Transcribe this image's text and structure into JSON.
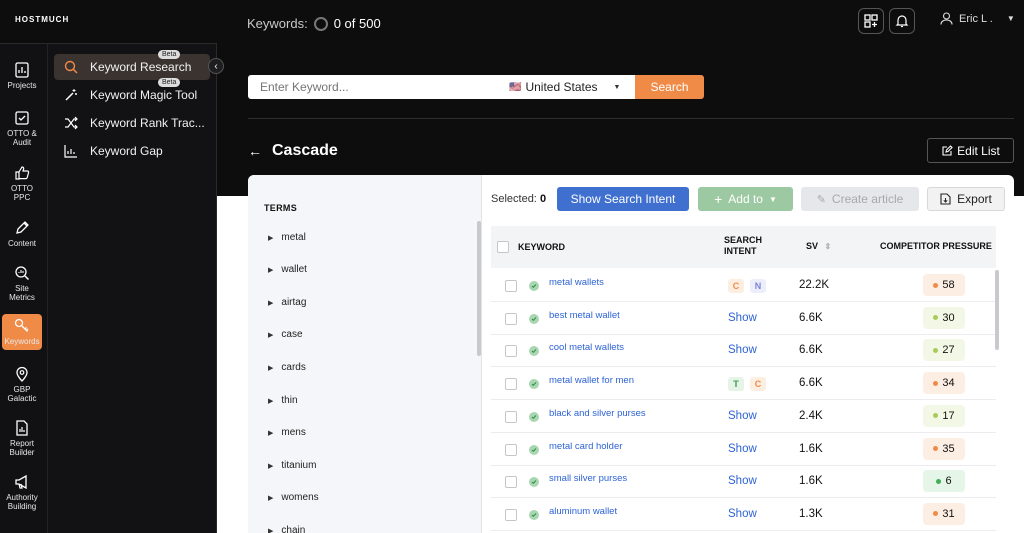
{
  "brand": "HOSTMUCH",
  "credits": {
    "label": "Keywords:",
    "value": "0 of 500"
  },
  "user": {
    "name": "Eric L ."
  },
  "rail": [
    {
      "label": "Projects",
      "icon": "chart-doc-icon"
    },
    {
      "label": "OTTO & Audit",
      "icon": "audit-icon"
    },
    {
      "label": "OTTO PPC",
      "icon": "thumbs-up-icon"
    },
    {
      "label": "Content",
      "icon": "pen-icon"
    },
    {
      "label": "Site Metrics",
      "icon": "metrics-icon"
    },
    {
      "label": "Keywords",
      "icon": "key-icon"
    },
    {
      "label": "GBP Galactic",
      "icon": "map-pin-icon"
    },
    {
      "label": "Report Builder",
      "icon": "report-icon"
    },
    {
      "label": "Authority Building",
      "icon": "megaphone-icon"
    }
  ],
  "submenu": [
    {
      "label": "Keyword Research",
      "badge": "Beta",
      "icon": "search-icon"
    },
    {
      "label": "Keyword Magic Tool",
      "badge": "Beta",
      "icon": "magic-wand-icon"
    },
    {
      "label": "Keyword Rank Trac...",
      "badge": "",
      "icon": "shuffle-icon"
    },
    {
      "label": "Keyword Gap",
      "badge": "",
      "icon": "gap-chart-icon"
    }
  ],
  "search": {
    "placeholder": "Enter Keyword...",
    "country": "United States",
    "flag": "🇺🇸",
    "button": "Search"
  },
  "page": {
    "title": "Cascade",
    "edit_list": "Edit List"
  },
  "terms": {
    "title": "TERMS",
    "items": [
      "metal",
      "wallet",
      "airtag",
      "case",
      "cards",
      "thin",
      "mens",
      "titanium",
      "womens",
      "chain"
    ]
  },
  "toolbar": {
    "selected_label": "Selected:",
    "selected_count": "0",
    "show_intent": "Show Search Intent",
    "add_to": "Add to",
    "create_article": "Create article",
    "export": "Export"
  },
  "table": {
    "headers": {
      "keyword": "KEYWORD",
      "intent_line1": "SEARCH",
      "intent_line2": "INTENT",
      "sv": "SV",
      "pressure": "COMPETITOR PRESSURE"
    },
    "rows": [
      {
        "keyword": "metal wallets",
        "intent": [
          "C",
          "N"
        ],
        "sv": "22.2K",
        "pressure": "58",
        "level": "orange"
      },
      {
        "keyword": "best metal wallet",
        "intent": "Show",
        "sv": "6.6K",
        "pressure": "30",
        "level": "lime"
      },
      {
        "keyword": "cool metal wallets",
        "intent": "Show",
        "sv": "6.6K",
        "pressure": "27",
        "level": "lime"
      },
      {
        "keyword": "metal wallet for men",
        "intent": [
          "T",
          "C"
        ],
        "sv": "6.6K",
        "pressure": "34",
        "level": "orange"
      },
      {
        "keyword": "black and silver purses",
        "intent": "Show",
        "sv": "2.4K",
        "pressure": "17",
        "level": "lime"
      },
      {
        "keyword": "metal card holder",
        "intent": "Show",
        "sv": "1.6K",
        "pressure": "35",
        "level": "orange"
      },
      {
        "keyword": "small silver purses",
        "intent": "Show",
        "sv": "1.6K",
        "pressure": "6",
        "level": "green"
      },
      {
        "keyword": "aluminum wallet",
        "intent": "Show",
        "sv": "1.3K",
        "pressure": "31",
        "level": "orange"
      }
    ]
  },
  "colors": {
    "accent": "#f08b47",
    "primary": "#3f6fcf",
    "link": "#2d63d5"
  }
}
